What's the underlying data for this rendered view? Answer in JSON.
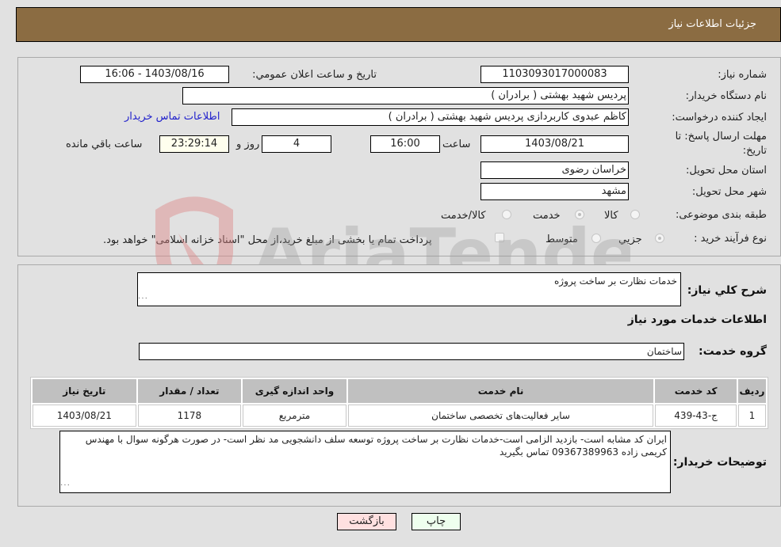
{
  "header": {
    "title": "جزئيات اطلاعات نياز"
  },
  "form": {
    "need_number": {
      "label": "شماره نياز:",
      "value": "1103093017000083"
    },
    "announce_datetime": {
      "label": "تاريخ و ساعت اعلان عمومي:",
      "value": "1403/08/16 - 16:06"
    },
    "buyer_org": {
      "label": "نام دستگاه خريدار:",
      "value": "پرديس شهيد بهشتی ( برادران )"
    },
    "requester": {
      "label": "ايجاد كننده درخواست:",
      "value": "كاظم  عبدوی  كاربردازی  پرديس شهيد بهشتی ( برادران )"
    },
    "buyer_contact_link": "اطلاعات تماس خريدار",
    "deadline": {
      "label_line1": "مهلت ارسال پاسخ: تا",
      "label_line2": "تاريخ:",
      "date": "1403/08/21",
      "time_label": "ساعت",
      "time": "16:00",
      "days": "4",
      "days_label": "روز و",
      "remaining": "23:29:14",
      "remaining_label": "ساعت باقي مانده"
    },
    "province": {
      "label": "استان محل تحويل:",
      "value": "خراسان رضوی"
    },
    "city": {
      "label": "شهر محل تحويل:",
      "value": "مشهد"
    },
    "category": {
      "label": "طبقه بندی موضوعی:",
      "options": [
        "كالا",
        "خدمت",
        "كالا/خدمت"
      ],
      "selected": "خدمت"
    },
    "purchase_type": {
      "label": "نوع فرآيند خريد :",
      "options": [
        "جزيي",
        "متوسط"
      ],
      "selected": "جزيي",
      "treasury_note": "پرداخت تمام يا بخشی از مبلغ خريد،از محل \"اسناد خزانه اسلامی\" خواهد بود."
    }
  },
  "details": {
    "summary_label": "شرح كلي نياز:",
    "summary_value": "خدمات نظارت بر ساخت پروژه",
    "services_heading": "اطلاعات خدمات مورد نياز",
    "service_group_label": "گروه خدمت:",
    "service_group_value": "ساختمان",
    "table": {
      "headers": [
        "رديف",
        "كد خدمت",
        "نام خدمت",
        "واحد اندازه گيری",
        "تعداد / مقدار",
        "تاريخ نياز"
      ],
      "rows": [
        [
          "1",
          "ج-43-439",
          "ساير فعاليت‌های تخصصی ساختمان",
          "مترمربع",
          "1178",
          "1403/08/21"
        ]
      ]
    },
    "buyer_notes_label": "توضيحات خريدار:",
    "buyer_notes_value": "ايران كد مشابه است- بازديد الزامی است-خدمات نظارت بر ساخت پروژه توسعه سلف دانشجويی مد نظر است- در صورت هرگونه سوال با مهندس كريمی  زاده 09367389963 تماس بگيريد"
  },
  "buttons": {
    "print": "چاپ",
    "back": "بازگشت"
  },
  "watermark": {
    "text": "AriaTender.neT"
  },
  "colors": {
    "header_bg": "#8b6c42",
    "back_button_bg": "#ffe0e0",
    "print_button_bg": "#eeffee",
    "link": "#2222cc"
  }
}
